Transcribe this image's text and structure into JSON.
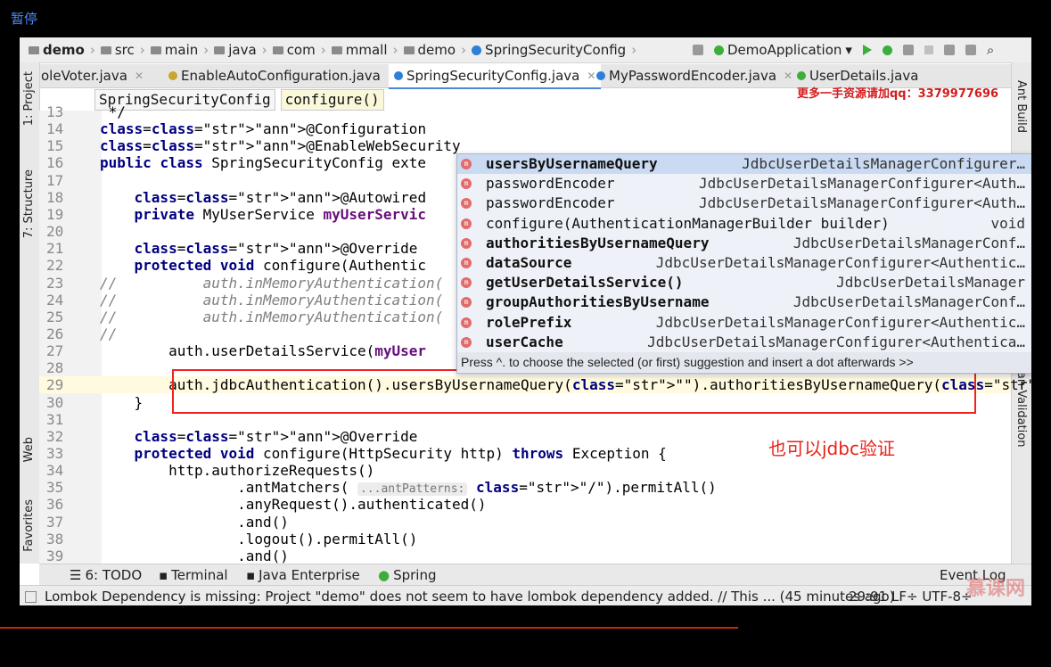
{
  "pause_label": "暂停",
  "breadcrumbs": [
    "demo",
    "src",
    "main",
    "java",
    "com",
    "mmall",
    "demo",
    "SpringSecurityConfig"
  ],
  "run_config": "DemoApplication",
  "tabs": [
    {
      "label": "oleVoter.java",
      "active": false
    },
    {
      "label": "EnableAutoConfiguration.java",
      "active": false
    },
    {
      "label": "SpringSecurityConfig.java",
      "active": true
    },
    {
      "label": "MyPasswordEncoder.java",
      "active": false
    },
    {
      "label": "UserDetails.java",
      "active": false
    }
  ],
  "watermark_top": "更多一手资源请加qq：3379977696",
  "editor_breadcrumbs": [
    "SpringSecurityConfig",
    "configure()"
  ],
  "left_tool_tabs": [
    "1: Project",
    "7: Structure",
    "Web",
    "Favorites"
  ],
  "right_tool_tabs": [
    "Ant Build",
    "Bean Validation"
  ],
  "code_lines": [
    {
      "n": "13",
      "text": " */"
    },
    {
      "n": "14",
      "text": "@Configuration"
    },
    {
      "n": "15",
      "text": "@EnableWebSecurity"
    },
    {
      "n": "16",
      "text": "public class SpringSecurityConfig exte"
    },
    {
      "n": "17",
      "text": ""
    },
    {
      "n": "18",
      "text": "    @Autowired"
    },
    {
      "n": "19",
      "text": "    private MyUserService myUserServic"
    },
    {
      "n": "20",
      "text": ""
    },
    {
      "n": "21",
      "text": "    @Override"
    },
    {
      "n": "22",
      "text": "    protected void configure(Authentic"
    },
    {
      "n": "23",
      "text": "//          auth.inMemoryAuthentication("
    },
    {
      "n": "24",
      "text": "//          auth.inMemoryAuthentication("
    },
    {
      "n": "25",
      "text": "//          auth.inMemoryAuthentication("
    },
    {
      "n": "26",
      "text": "//"
    },
    {
      "n": "27",
      "text": "        auth.userDetailsService(myUser"
    },
    {
      "n": "28",
      "text": ""
    },
    {
      "n": "29",
      "text": "        auth.jdbcAuthentication().usersByUsernameQuery(\"\").authoritiesByUsernameQuery(\"\")."
    },
    {
      "n": "30",
      "text": "    }"
    },
    {
      "n": "31",
      "text": ""
    },
    {
      "n": "32",
      "text": "    @Override"
    },
    {
      "n": "33",
      "text": "    protected void configure(HttpSecurity http) throws Exception {"
    },
    {
      "n": "34",
      "text": "        http.authorizeRequests()"
    },
    {
      "n": "35",
      "text": "                .antMatchers( ...antPatterns: \"/\").permitAll()"
    },
    {
      "n": "36",
      "text": "                .anyRequest().authenticated()"
    },
    {
      "n": "37",
      "text": "                .and()"
    },
    {
      "n": "38",
      "text": "                .logout().permitAll()"
    },
    {
      "n": "39",
      "text": "                .and()"
    }
  ],
  "completion": {
    "items": [
      {
        "name": "usersByUsernameQuery",
        "type": "JdbcUserDetailsManagerConfigurer…",
        "bold": true
      },
      {
        "name": "passwordEncoder",
        "type": "JdbcUserDetailsManagerConfigurer<Auth…",
        "bold": false
      },
      {
        "name": "passwordEncoder",
        "type": "JdbcUserDetailsManagerConfigurer<Auth…",
        "bold": false
      },
      {
        "name": "configure(AuthenticationManagerBuilder builder)",
        "type": "void",
        "bold": false
      },
      {
        "name": "authoritiesByUsernameQuery",
        "type": "JdbcUserDetailsManagerConf…",
        "bold": true
      },
      {
        "name": "dataSource",
        "type": "JdbcUserDetailsManagerConfigurer<Authentic…",
        "bold": true
      },
      {
        "name": "getUserDetailsService()",
        "type": "JdbcUserDetailsManager",
        "bold": true
      },
      {
        "name": "groupAuthoritiesByUsername",
        "type": "JdbcUserDetailsManagerConf…",
        "bold": true
      },
      {
        "name": "rolePrefix",
        "type": "JdbcUserDetailsManagerConfigurer<Authentic…",
        "bold": true
      },
      {
        "name": "userCache",
        "type": "JdbcUserDetailsManagerConfigurer<Authentica…",
        "bold": true
      }
    ],
    "hint": "Press ^. to choose the selected (or first) suggestion and insert a dot afterwards  >>"
  },
  "note": "也可以jdbc验证",
  "tool_windows": [
    "6: TODO",
    "Terminal",
    "Java Enterprise",
    "Spring",
    "Event Log"
  ],
  "status": {
    "message": "Lombok Dependency is missing: Project \"demo\" does not seem to have lombok dependency added. // This ... (45 minutes ago)",
    "position": "29:91  LF÷  UTF-8÷"
  },
  "brand": "慕课网"
}
